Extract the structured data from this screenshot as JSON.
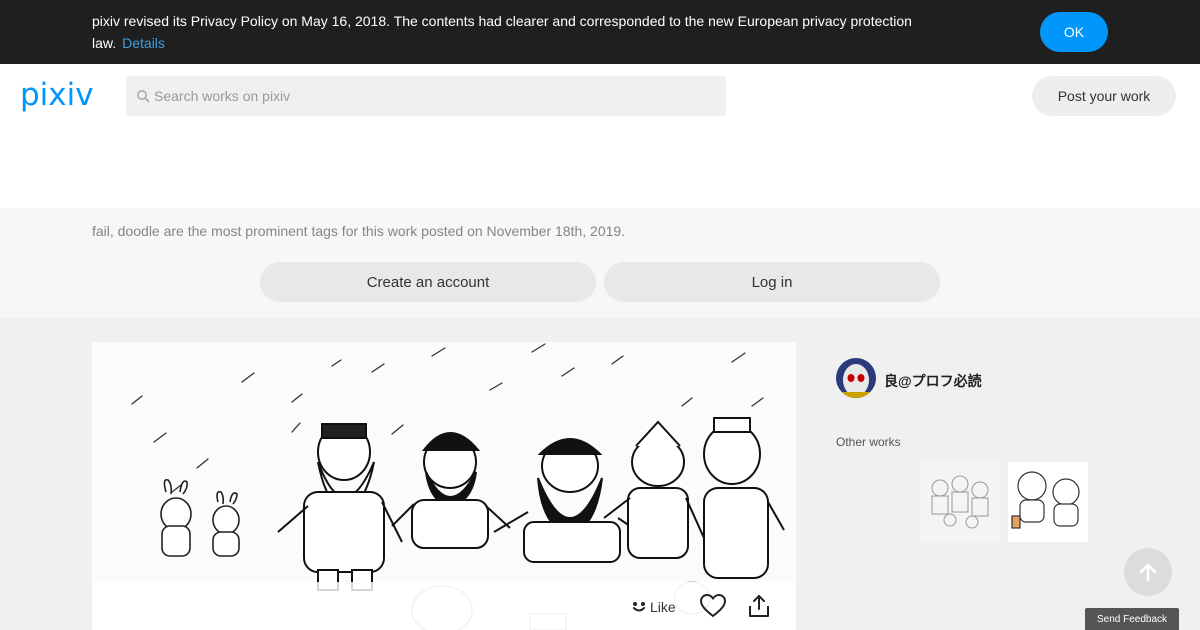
{
  "privacy_banner": {
    "message": "pixiv revised its Privacy Policy on May 16, 2018. The contents had clearer and corresponded to the new European privacy protection law.",
    "details_link": "Details",
    "ok_button": "OK"
  },
  "header": {
    "logo_text": "pixiv",
    "search": {
      "placeholder": "Search works on pixiv",
      "value": ""
    },
    "post_button": "Post your work"
  },
  "signup": {
    "tag_sentence": "fail, doodle are the most prominent tags for this work posted on November 18th, 2019.",
    "create_account_button": "Create an account",
    "login_button": "Log in"
  },
  "artwork": {
    "actions": {
      "like_label": "Like"
    }
  },
  "sidebar": {
    "author_name": "良@プロフ必読",
    "other_works_label": "Other works"
  },
  "utility": {
    "feedback_button": "Send Feedback"
  },
  "colors": {
    "brand_blue": "#0096fa",
    "banner_bg": "#1f1f1f",
    "link_blue": "#3d9fe0"
  },
  "icons": [
    "search-icon",
    "like-icon",
    "heart-icon",
    "share-icon",
    "arrow-up-icon"
  ]
}
